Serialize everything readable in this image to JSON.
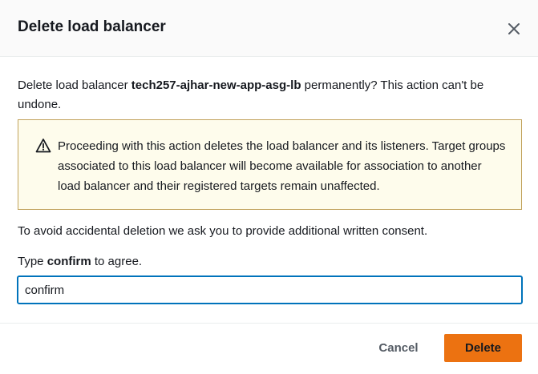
{
  "dialog": {
    "title": "Delete load balancer"
  },
  "body": {
    "prefix": "Delete load balancer ",
    "lb_name": "tech257-ajhar-new-app-asg-lb",
    "suffix": " permanently? This action can't be undone."
  },
  "alert": {
    "message": "Proceeding with this action deletes the load balancer and its listeners. Target groups associated to this load balancer will become available for association to another load balancer and their registered targets remain unaffected.",
    "icon": "warning-icon"
  },
  "consent": {
    "text": "To avoid accidental deletion we ask you to provide additional written consent.",
    "label_prefix": "Type ",
    "label_keyword": "confirm",
    "label_suffix": " to agree.",
    "input_value": "confirm"
  },
  "footer": {
    "cancel_label": "Cancel",
    "delete_label": "Delete"
  },
  "colors": {
    "primary_button": "#ec7211",
    "input_focus_border": "#0073bb",
    "alert_background": "#fefcec",
    "alert_border": "#c1a25b"
  }
}
